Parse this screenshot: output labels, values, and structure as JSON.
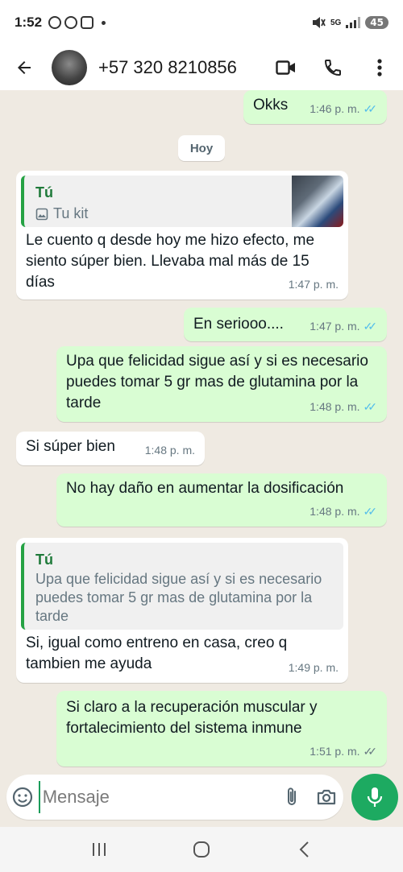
{
  "status": {
    "time": "1:52",
    "battery": "45",
    "network": "5G"
  },
  "header": {
    "contact_name": "+57 320 8210856",
    "icons": [
      "back-arrow-icon",
      "video-call-icon",
      "phone-call-icon",
      "more-vert-icon"
    ]
  },
  "chat": {
    "day_label": "Hoy",
    "messages": [
      {
        "dir": "out",
        "text": "Okks",
        "time": "1:46 p. m.",
        "read": true
      },
      {
        "dir": "in",
        "quote": {
          "author": "Tú",
          "text": "Tu kit",
          "has_image": true
        },
        "text": "Le cuento q desde hoy me hizo efecto, me siento súper bien. Llevaba mal más de 15 días",
        "time": "1:47 p. m."
      },
      {
        "dir": "out",
        "text": "En seriooo....",
        "time": "1:47 p. m.",
        "read": true
      },
      {
        "dir": "out",
        "text": "Upa que felicidad sigue así y si es necesario puedes tomar 5 gr mas de glutamina por la tarde",
        "time": "1:48 p. m.",
        "read": true
      },
      {
        "dir": "in",
        "text": "Si súper bien",
        "time": "1:48 p. m."
      },
      {
        "dir": "out",
        "text": "No hay daño en aumentar la dosificación",
        "time": "1:48 p. m.",
        "read": true
      },
      {
        "dir": "in",
        "quote": {
          "author": "Tú",
          "text": "Upa que felicidad sigue así y si es necesario puedes tomar 5 gr mas de glutamina por la tarde"
        },
        "text": "Si, igual como entreno en casa, creo q tambien me ayuda",
        "time": "1:49 p. m."
      },
      {
        "dir": "out",
        "text": "Si claro a la recuperación muscular y fortalecimiento del sistema inmune",
        "time": "1:51 p. m.",
        "read": false
      }
    ]
  },
  "composer": {
    "placeholder": "Mensaje"
  },
  "colors": {
    "outgoing_bubble": "#d9fdd3",
    "incoming_bubble": "#ffffff",
    "chat_background": "#efeae2",
    "accent": "#1daa61",
    "read_ticks": "#53bdeb"
  }
}
